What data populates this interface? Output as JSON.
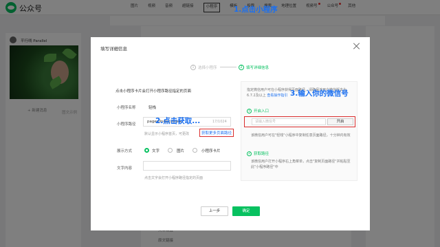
{
  "app": {
    "brand": "公众号"
  },
  "toolbar": {
    "items": [
      {
        "label": "图片",
        "highlighted": false,
        "badge": false
      },
      {
        "label": "视频",
        "highlighted": false,
        "badge": false
      },
      {
        "label": "音频",
        "highlighted": false,
        "badge": false
      },
      {
        "label": "超链接",
        "highlighted": false,
        "badge": false
      },
      {
        "label": "小程序",
        "highlighted": true,
        "badge": false
      },
      {
        "label": "模板",
        "highlighted": false,
        "badge": false
      },
      {
        "label": "投票",
        "highlighted": false,
        "badge": false
      },
      {
        "label": "搜索",
        "highlighted": false,
        "badge": false
      },
      {
        "label": "地理位置",
        "highlighted": false,
        "badge": false
      },
      {
        "label": "视频号",
        "highlighted": false,
        "badge": true
      },
      {
        "label": "公众号",
        "highlighted": false,
        "badge": true
      },
      {
        "label": "其他",
        "highlighted": false,
        "badge": false
      }
    ]
  },
  "background": {
    "author": "平行线 Parallel",
    "new_message": "+ 新建消息",
    "side_text": "图文示例",
    "bottom_1": "文章设置",
    "bottom_2": "原文链接"
  },
  "annotations": {
    "step1": "1.点击小程序",
    "step2": "2.点击获取...",
    "step3": "3.输入你的微信号"
  },
  "modal": {
    "title": "填写详细信息",
    "steps": [
      {
        "num": "1",
        "label": "选择小程序"
      },
      {
        "num": "2",
        "label": "填写详细信息"
      }
    ],
    "description": "点击小程序卡片会打开小程序路径指定的页面",
    "app_name_label": "小程序名称",
    "app_name_value": "轻栈",
    "path_label": "小程序路径",
    "path_value": "pages/index/index",
    "path_counter": "17/1024",
    "path_note": "默认显示小程序首页，可更改",
    "get_path_link": "获取更多页面路径",
    "display_label": "展示方式",
    "display_options": [
      {
        "label": "文字",
        "selected": true
      },
      {
        "label": "图片",
        "selected": false
      },
      {
        "label": "小程序卡片",
        "selected": false
      }
    ],
    "text_label": "文字内容",
    "text_note": "点击文字会打开小程序路径指定的页面",
    "help": {
      "intro": "指定微信用户可在小程序获得页面路径，请确保该用户微信版本为6.7.2及以上",
      "intro_link": "查看操作指引",
      "step1_num": "1",
      "step1_title": "开启入口",
      "appid_placeholder": "请输入微信号",
      "open_button": "开启",
      "step1_desc": "该微信用户可在\"轻栈\"小程序中复制任意页面路径，十分钟内有效",
      "step2_num": "2",
      "step2_title": "获取路径",
      "step2_desc": "该微信用户打开小程序右上角菜单，点击\"复制页面路径\"并粘贴至此\"小程序路径\"中"
    },
    "prev_button": "上一步",
    "confirm_button": "确定"
  }
}
